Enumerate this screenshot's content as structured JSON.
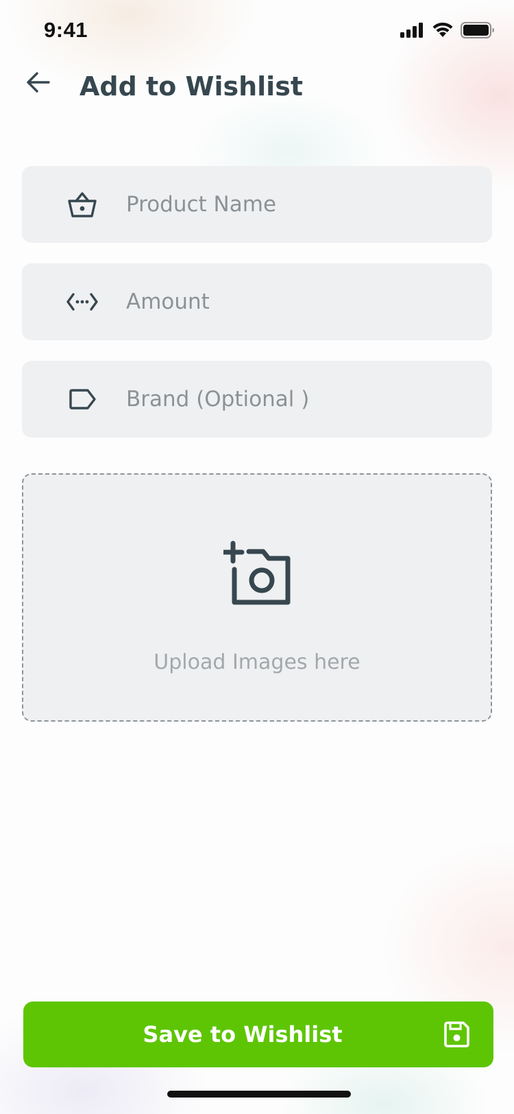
{
  "status_bar": {
    "time": "9:41",
    "icons": [
      "cellular-signal-icon",
      "wifi-icon",
      "battery-icon"
    ]
  },
  "header": {
    "back_icon": "arrow-left-icon",
    "title": "Add to Wishlist"
  },
  "form": {
    "product_name": {
      "icon": "basket-icon",
      "placeholder": "Product Name",
      "value": ""
    },
    "amount": {
      "icon": "code-dots-icon",
      "placeholder": "Amount",
      "value": ""
    },
    "brand": {
      "icon": "tag-icon",
      "placeholder": "Brand (Optional )",
      "value": ""
    }
  },
  "upload": {
    "icon": "add-camera-icon",
    "label": "Upload Images here"
  },
  "save_button": {
    "label": "Save to Wishlist",
    "icon": "floppy-disk-icon"
  },
  "colors": {
    "accent": "#5ec504",
    "text_dark": "#37474f",
    "field_bg": "#eff0f2",
    "placeholder": "#8b9296"
  }
}
